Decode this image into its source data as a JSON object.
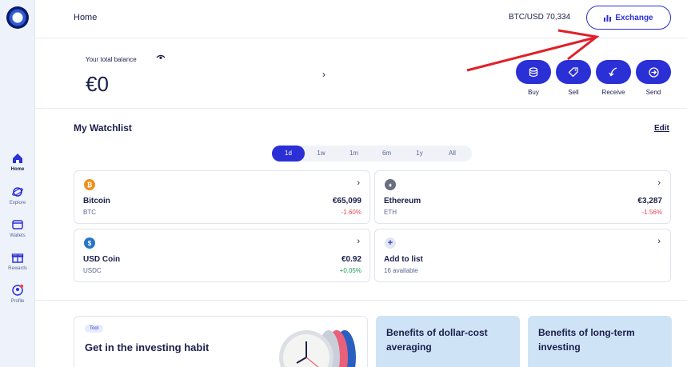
{
  "sidebar": {
    "items": [
      {
        "label": "Home",
        "icon": "home-icon"
      },
      {
        "label": "Explore",
        "icon": "explore-icon"
      },
      {
        "label": "Wallets",
        "icon": "wallet-icon"
      },
      {
        "label": "Rewards",
        "icon": "gift-icon"
      },
      {
        "label": "Profile",
        "icon": "profile-icon"
      }
    ]
  },
  "header": {
    "breadcrumb": "Home",
    "ticker": "BTC/USD 70,334",
    "exchange_label": "Exchange"
  },
  "balance": {
    "label": "Your total balance",
    "value": "€0",
    "actions": [
      {
        "label": "Buy",
        "icon": "coins-icon"
      },
      {
        "label": "Sell",
        "icon": "tag-icon"
      },
      {
        "label": "Receive",
        "icon": "receive-arrow-icon"
      },
      {
        "label": "Send",
        "icon": "send-arrow-icon"
      }
    ]
  },
  "watchlist": {
    "title": "My Watchlist",
    "edit_label": "Edit",
    "periods": [
      "1d",
      "1w",
      "1m",
      "6m",
      "1y",
      "All"
    ],
    "active_period": "1d",
    "assets": [
      {
        "name": "Bitcoin",
        "symbol": "BTC",
        "price": "€65,099",
        "change": "-1.60%",
        "color": "#f0901d",
        "glyph": "₿"
      },
      {
        "name": "Ethereum",
        "symbol": "ETH",
        "price": "€3,287",
        "change": "-1.56%",
        "color": "#6b7080",
        "glyph": "♦"
      },
      {
        "name": "USD Coin",
        "symbol": "USDC",
        "price": "€0.92",
        "change": "+0.05%",
        "color": "#2775ca",
        "glyph": "$"
      }
    ],
    "add": {
      "title": "Add to list",
      "subtitle": "16 available"
    }
  },
  "promos": [
    {
      "tag": "Tool",
      "title": "Get in the investing habit"
    },
    {
      "title": "Benefits of dollar-cost averaging"
    },
    {
      "title": "Benefits of long-term investing"
    }
  ],
  "colors": {
    "accent": "#2b2fd6",
    "annotation": "#e0202a",
    "negative": "#e0475a",
    "positive": "#1f9d5a"
  }
}
